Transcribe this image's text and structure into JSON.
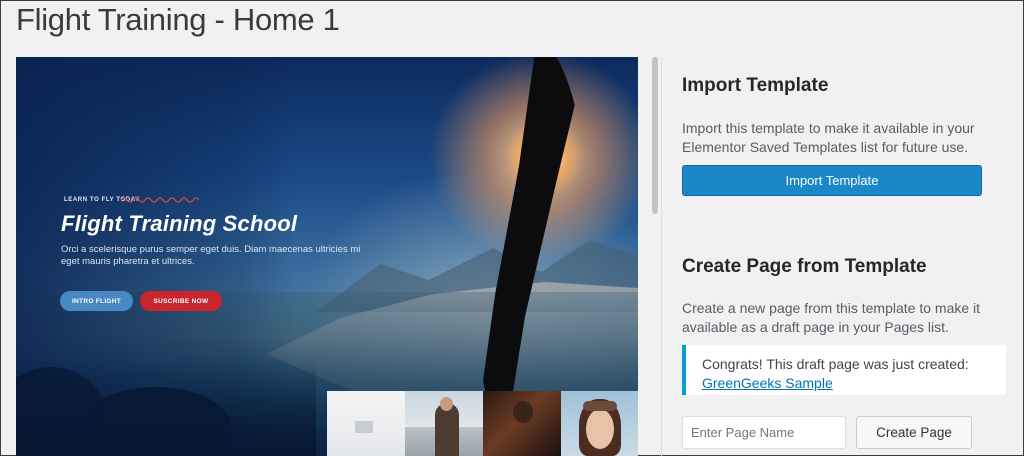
{
  "page": {
    "title": "Flight Training - Home 1"
  },
  "preview": {
    "kicker": "LEARN TO FLY TODAY",
    "title": "Flight Training School",
    "text": "Orci a scelerisque purus semper eget duis. Diam maecenas ultricies mi eget mauris pharetra et ultrices.",
    "buttons": {
      "intro": "INTRO FLIGHT",
      "subscribe": "SUSCRIBE NOW"
    },
    "colors": {
      "intro": "#4a88c3",
      "subscribe": "#c9252c"
    }
  },
  "import": {
    "heading": "Import Template",
    "description": "Import this template to make it available in your Elementor Saved Templates list for future use.",
    "button": "Import Template"
  },
  "create": {
    "heading": "Create Page from Template",
    "description": "Create a new page from this template to make it available as a draft page in your Pages list.",
    "notice": {
      "text": "Congrats! This draft page was just created:",
      "link": "GreenGeeks Sample"
    },
    "input": {
      "placeholder": "Enter Page Name",
      "value": ""
    },
    "button": "Create Page"
  },
  "colors": {
    "accent": "#1a88c6",
    "notice_border": "#00a0d2",
    "link": "#0073aa"
  }
}
